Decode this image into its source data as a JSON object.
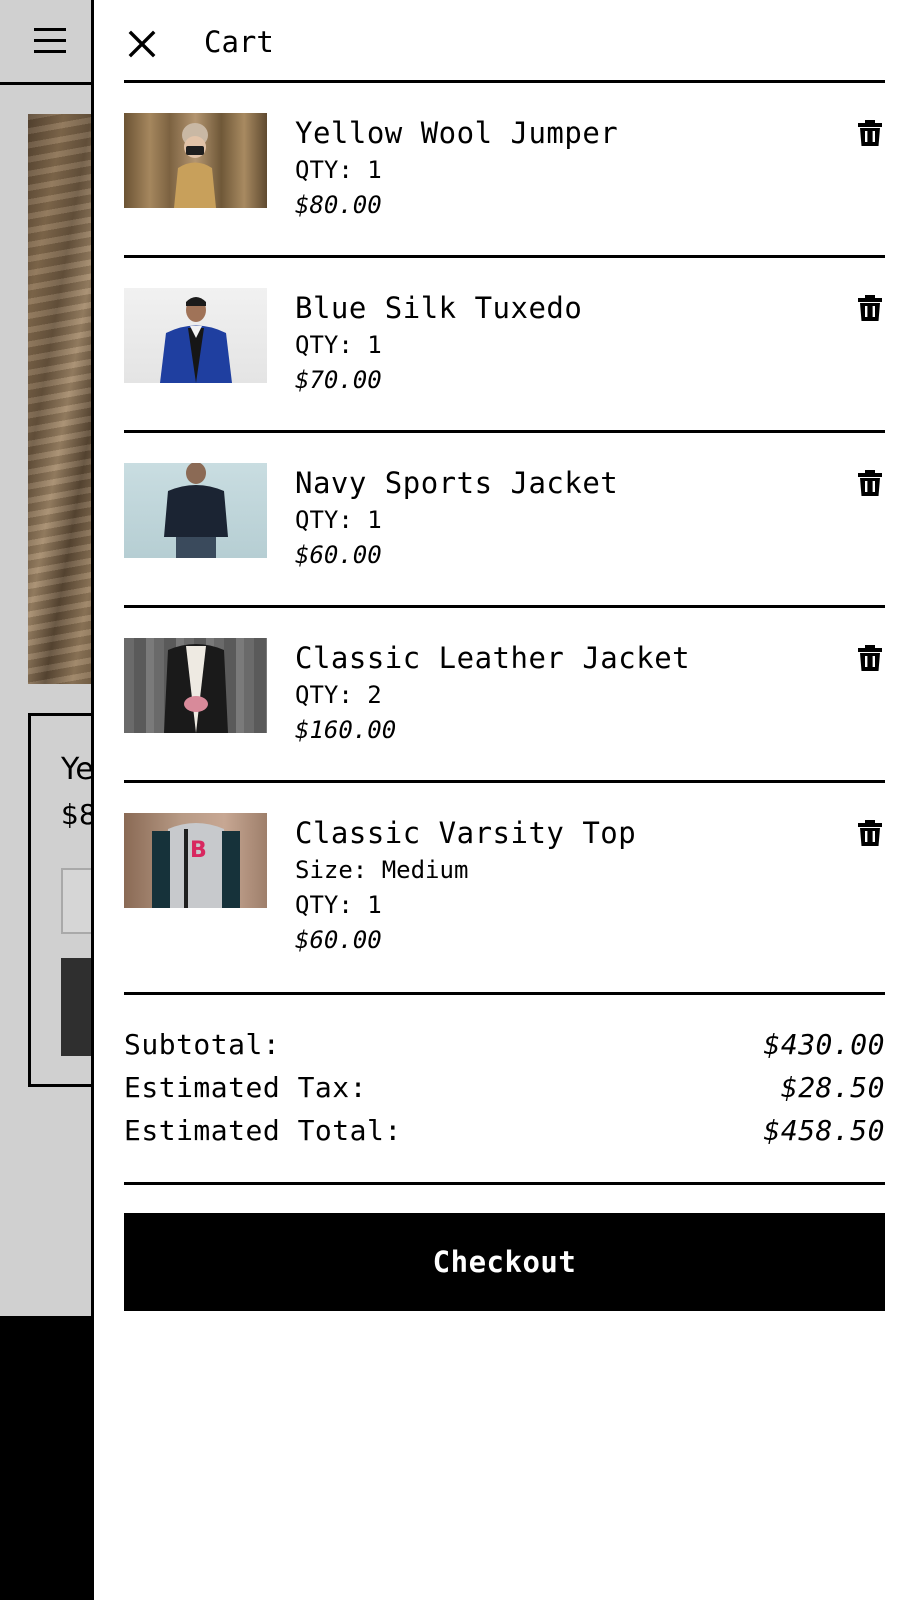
{
  "background": {
    "card": {
      "title": "Ye",
      "price": "$8"
    }
  },
  "drawer": {
    "title": "Cart",
    "close_icon": "close-icon",
    "items": [
      {
        "name": "Yellow Wool Jumper",
        "qty": "QTY: 1",
        "price": "$80.00",
        "thumb": "person-with-camera-in-cornfield"
      },
      {
        "name": "Blue Silk Tuxedo",
        "qty": "QTY: 1",
        "price": "$70.00",
        "thumb": "man-in-blue-tuxedo"
      },
      {
        "name": "Navy Sports Jacket",
        "qty": "QTY: 1",
        "price": "$60.00",
        "thumb": "man-in-navy-jacket-back-view"
      },
      {
        "name": "Classic Leather Jacket",
        "qty": "QTY: 2",
        "price": "$160.00",
        "thumb": "person-in-leather-jacket-holding-mug"
      },
      {
        "name": "Classic Varsity Top",
        "size": "Size: Medium",
        "qty": "QTY: 1",
        "price": "$60.00",
        "thumb": "woman-in-varsity-jacket"
      }
    ],
    "delete_icon": "trash-icon",
    "totals": {
      "subtotal_label": "Subtotal:",
      "subtotal_value": "$430.00",
      "tax_label": "Estimated Tax:",
      "tax_value": "$28.50",
      "total_label": "Estimated Total:",
      "total_value": "$458.50"
    },
    "checkout_label": "Checkout"
  },
  "colors": {
    "drawer_bg": "#ffffff",
    "page_bg": "#d0d0d0",
    "accent": "#000000",
    "button_text": "#ffffff"
  }
}
